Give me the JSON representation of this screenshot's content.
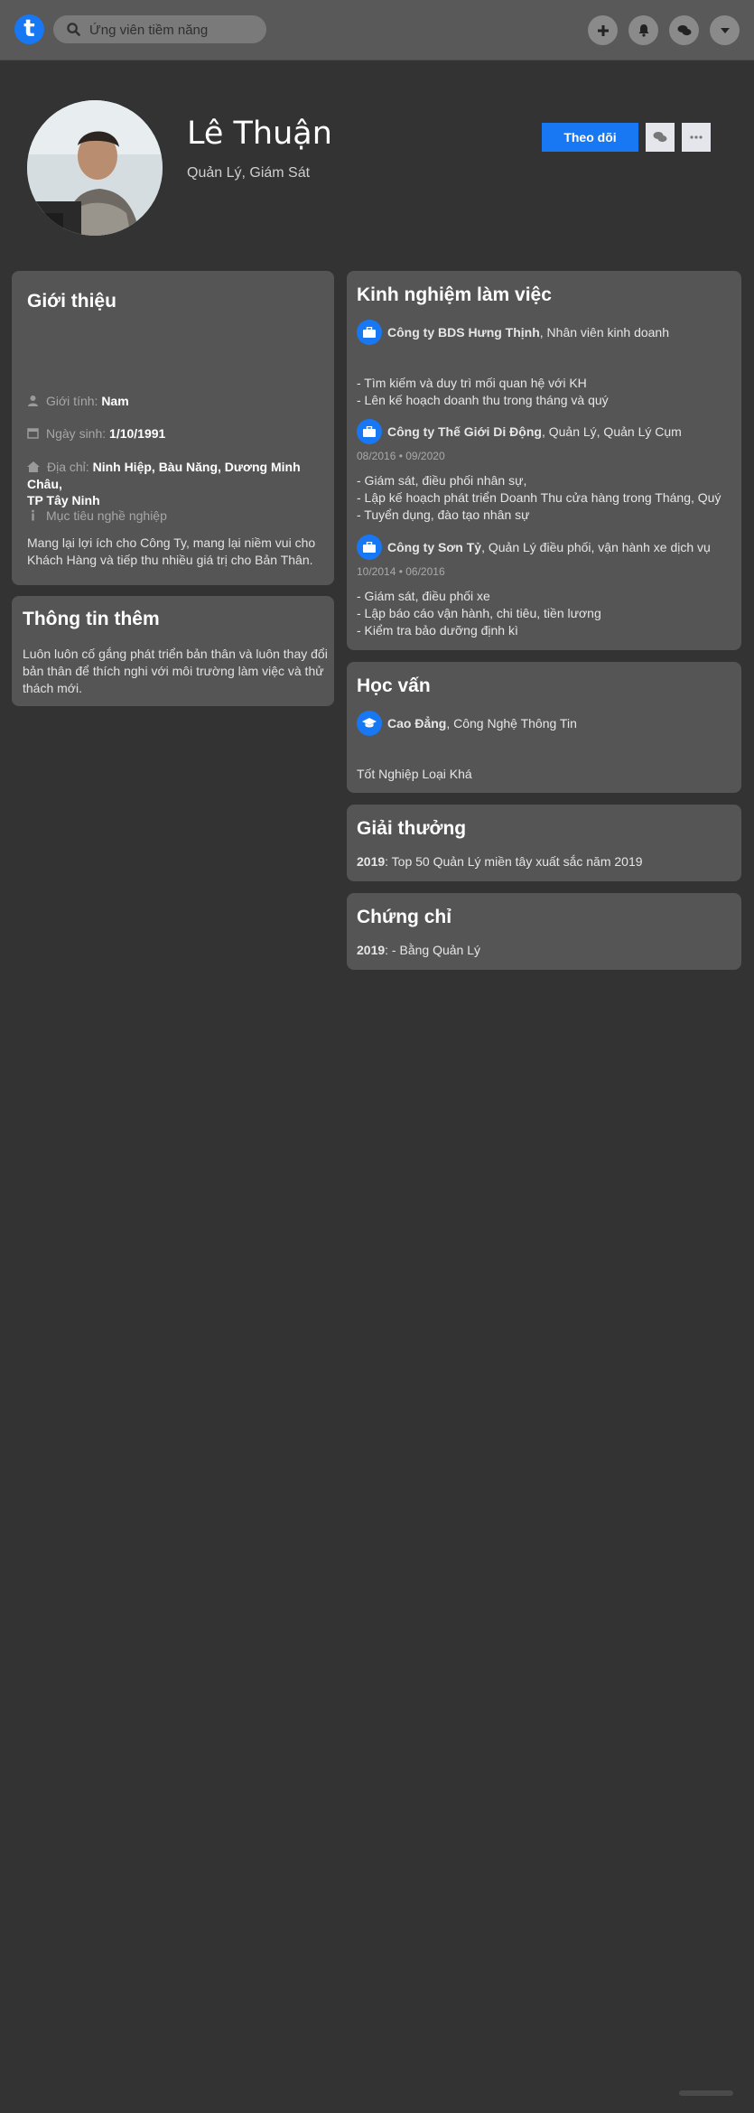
{
  "search": {
    "placeholder": "Ứng viên tiềm năng"
  },
  "topbar": {
    "icons": [
      "plus-icon",
      "bell-icon",
      "chat-icon",
      "caret-down-icon"
    ]
  },
  "profile": {
    "name": "Lê Thuận",
    "title": "Quản Lý, Giám Sát",
    "follow_label": "Theo dõi"
  },
  "intro": {
    "heading": "Giới thiệu",
    "gender_label": "Giới tính:",
    "gender": "Nam",
    "dob_label": "Ngày sinh:",
    "dob": "1/10/1991",
    "address_label": "Địa chỉ:",
    "address_line1": "Ninh Hiệp, Bàu Năng, Dương Minh Châu,",
    "address_line2": "TP Tây Ninh",
    "goal_label": "Mục tiêu nghề nghiệp",
    "goal_line1": "Mang lại lợi ích cho Công Ty, mang lại niềm vui cho",
    "goal_line2": "Khách Hàng và tiếp thu nhiều giá trị cho Bản Thân."
  },
  "more_info": {
    "heading": "Thông tin thêm",
    "line1": "Luôn luôn cố gắng phát triển bản thân và luôn thay đổi",
    "line2": "bản thân để thích nghi với môi trường làm việc và thử",
    "line3": "thách mới."
  },
  "experience": {
    "heading": "Kinh nghiệm làm việc",
    "items": [
      {
        "company": "Công ty BDS Hưng Thịnh",
        "role": ", Nhân viên kinh doanh",
        "dates": "",
        "duties": [
          "- Tìm kiếm và duy trì mối quan hệ với KH",
          "- Lên kế hoạch doanh thu trong tháng và quý"
        ]
      },
      {
        "company": "Công ty Thế Giới Di Động",
        "role": ", Quản Lý, Quản Lý Cụm",
        "dates": "08/2016  •  09/2020",
        "duties": [
          "- Giám sát, điều phối nhân sự,",
          "- Lập kế hoạch phát triển Doanh Thu cửa hàng trong Tháng, Quý",
          "- Tuyển dụng, đào tạo nhân sự"
        ]
      },
      {
        "company": "Công ty Sơn Tỷ",
        "role": ", Quản Lý điều phối, vận hành xe dịch vụ",
        "dates": "10/2014  •  06/2016",
        "duties": [
          "- Giám sát, điều phối xe",
          "- Lập báo cáo vận hành, chi tiêu, tiền lương",
          "- Kiểm tra bảo dưỡng định kì"
        ]
      }
    ]
  },
  "education": {
    "heading": "Học vấn",
    "degree": "Cao Đẳng",
    "major": ", Công Nghệ Thông Tin",
    "grade": "Tốt Nghiệp Loại Khá"
  },
  "awards": {
    "heading": "Giải thưởng",
    "year": "2019",
    "text": ": Top 50 Quản Lý miền tây xuất sắc năm 2019"
  },
  "certificates": {
    "heading": "Chứng chỉ",
    "year": "2019",
    "text": ": - Bằng Quản Lý"
  },
  "colors": {
    "accent": "#1877f2",
    "background": "#333333",
    "card": "#555555",
    "topbar": "#595959"
  }
}
